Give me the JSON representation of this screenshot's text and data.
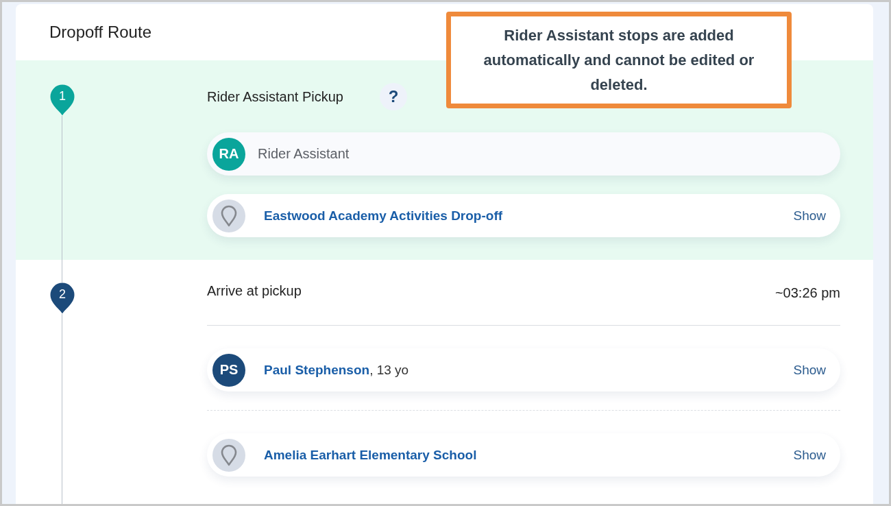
{
  "header": {
    "title": "Dropoff Route"
  },
  "tooltip": {
    "text": "Rider Assistant stops are added automatically and cannot be edited or deleted."
  },
  "stops": [
    {
      "number": "1",
      "color": "#0aa59b",
      "highlighted": true,
      "title": "Rider Assistant Pickup",
      "help": "?",
      "entries": [
        {
          "kind": "person",
          "initials": "RA",
          "color": "#0aa59b",
          "name": "Rider Assistant",
          "disabled": true
        },
        {
          "kind": "location",
          "name": "Eastwood Academy Activities Drop-off",
          "action": "Show",
          "disabled": false
        }
      ]
    },
    {
      "number": "2",
      "color": "#1c4a7a",
      "highlighted": false,
      "title": "Arrive at pickup",
      "time": "~03:26 pm",
      "entries": [
        {
          "kind": "person",
          "initials": "PS",
          "color": "#1c4a7a",
          "name": "Paul Stephenson",
          "detail": ", 13 yo",
          "action": "Show",
          "disabled": false
        },
        {
          "kind": "location",
          "name": "Amelia Earhart Elementary School",
          "action": "Show",
          "disabled": false
        }
      ]
    }
  ]
}
